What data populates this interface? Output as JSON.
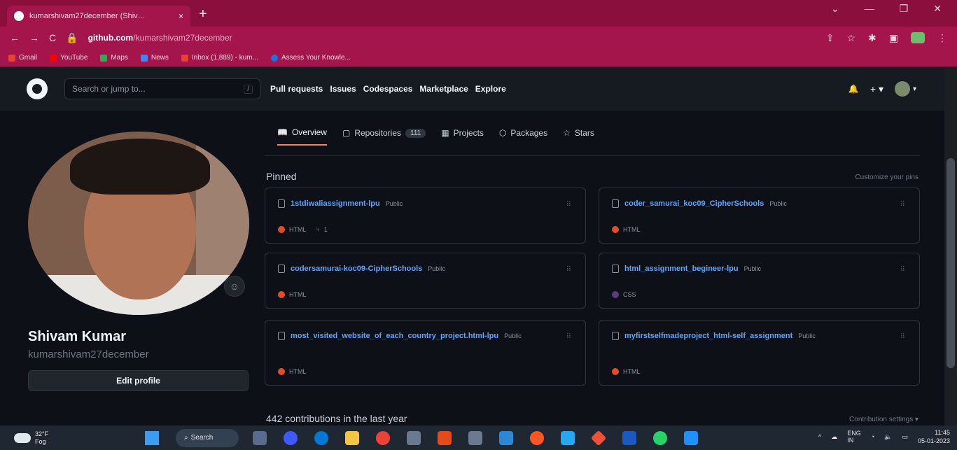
{
  "browser": {
    "tab_title": "kumarshivam27december (Shiv…",
    "tab_close": "×",
    "new_tab": "+",
    "window_controls": [
      "⌄",
      "—",
      "❐",
      "✕"
    ],
    "nav_icons": [
      "←",
      "→",
      "C"
    ],
    "url_host": "github.com",
    "url_path": "/kumarshivam27december",
    "right_icons": [
      "⇪",
      "☆",
      "✱",
      "▣",
      "⋮"
    ],
    "bookmarks": [
      {
        "label": "Gmail",
        "color": "#e94235"
      },
      {
        "label": "YouTube",
        "color": "#ff0000"
      },
      {
        "label": "Maps",
        "color": "#34a853"
      },
      {
        "label": "News",
        "color": "#4285f4"
      },
      {
        "label": "Inbox (1,889) - kum...",
        "color": "#e94235"
      },
      {
        "label": "Assess Your Knowle...",
        "color": "#1a73e8"
      }
    ]
  },
  "header": {
    "search_placeholder": "Search or jump to...",
    "search_key": "/",
    "nav": [
      "Pull requests",
      "Issues",
      "Codespaces",
      "Marketplace",
      "Explore"
    ],
    "bell": "🔔",
    "plus": "+ ▾",
    "avatar_caret": "▾"
  },
  "profile_tabs": {
    "overview": "Overview",
    "repositories": "Repositories",
    "repo_count": "111",
    "projects": "Projects",
    "packages": "Packages",
    "stars": "Stars"
  },
  "profile": {
    "name": "Shivam Kumar",
    "login": "kumarshivam27december",
    "edit_label": "Edit profile",
    "emoji_icon": "☺"
  },
  "pinned": {
    "heading": "Pinned",
    "customize": "Customize your pins",
    "cards": [
      {
        "name": "1stdiwaliassignment-lpu",
        "visibility": "Public",
        "language": "HTML",
        "lang_color": "#e34c26",
        "forks": "1"
      },
      {
        "name": "coder_samurai_koc09_CipherSchools",
        "visibility": "Public",
        "language": "HTML",
        "lang_color": "#e34c26"
      },
      {
        "name": "codersamurai-koc09-CipherSchools",
        "visibility": "Public",
        "language": "HTML",
        "lang_color": "#e34c26"
      },
      {
        "name": "html_assignment_begineer-lpu",
        "visibility": "Public",
        "language": "CSS",
        "lang_color": "#563d7c"
      },
      {
        "name": "most_visited_website_of_each_country_project.html-lpu",
        "visibility": "Public",
        "language": "HTML",
        "lang_color": "#e34c26"
      },
      {
        "name": "myfirstselfmadeproject_html-self_assignment",
        "visibility": "Public",
        "language": "HTML",
        "lang_color": "#e34c26"
      }
    ]
  },
  "contributions": {
    "heading": "442 contributions in the last year",
    "settings": "Contribution settings ▾"
  },
  "taskbar": {
    "temp": "32°F",
    "weather": "Fog",
    "search": "Search",
    "lang": "ENG",
    "region": "IN",
    "time": "11:45",
    "date": "05-01-2023",
    "app_colors": [
      "#5b6b8c",
      "#3d5afe",
      "#0078d4",
      "#f4c542",
      "#ea4335",
      "#6b7a8f",
      "#e64a19",
      "#6b7a8f",
      "#2b88d8",
      "#ff5722",
      "#23a9f2",
      "#f05033",
      "#185abd",
      "#25d366",
      "#1e90ff"
    ]
  }
}
